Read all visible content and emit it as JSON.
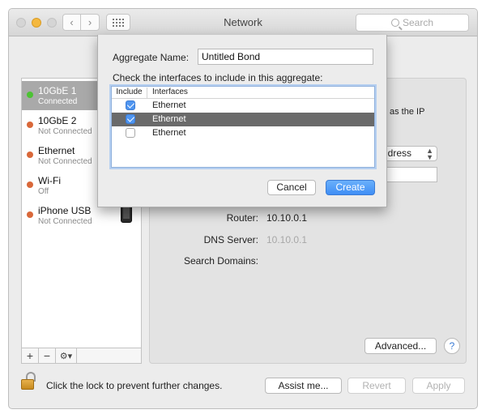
{
  "window": {
    "title": "Network"
  },
  "search": {
    "placeholder": "Search"
  },
  "sidebar": {
    "items": [
      {
        "name": "10GbE 1",
        "status": "Connected",
        "dot_color": "#4cc233",
        "selected": true
      },
      {
        "name": "10GbE 2",
        "status": "Not Connected",
        "dot_color": "#d9683a"
      },
      {
        "name": "Ethernet",
        "status": "Not Connected",
        "dot_color": "#d9683a"
      },
      {
        "name": "Wi-Fi",
        "status": "Off",
        "dot_color": "#d9683a"
      },
      {
        "name": "iPhone USB",
        "status": "Not Connected",
        "dot_color": "#d9683a"
      }
    ],
    "add_label": "+",
    "remove_label": "−",
    "action_label": "⚙▾"
  },
  "main": {
    "partial_ip_text": "as the IP",
    "configure_partial": "ddress",
    "router_label": "Router:",
    "router_value": "10.10.0.1",
    "dns_label": "DNS Server:",
    "dns_value": "10.10.0.1",
    "search_domains_label": "Search Domains:",
    "advanced_label": "Advanced...",
    "help_label": "?"
  },
  "footer": {
    "lock_text": "Click the lock to prevent further changes.",
    "assist_label": "Assist me...",
    "revert_label": "Revert",
    "apply_label": "Apply"
  },
  "sheet": {
    "name_label": "Aggregate Name:",
    "name_value": "Untitled Bond",
    "instructions": "Check the interfaces to include in this aggregate:",
    "columns": [
      "Include",
      "Interfaces"
    ],
    "rows": [
      {
        "interface": "Ethernet",
        "checked": true,
        "selected": false
      },
      {
        "interface": "Ethernet",
        "checked": true,
        "selected": true
      },
      {
        "interface": "Ethernet",
        "checked": false,
        "selected": false
      }
    ],
    "cancel_label": "Cancel",
    "create_label": "Create"
  },
  "colors": {
    "accent": "#3f8ef5",
    "selection": "#a9a9a9"
  }
}
